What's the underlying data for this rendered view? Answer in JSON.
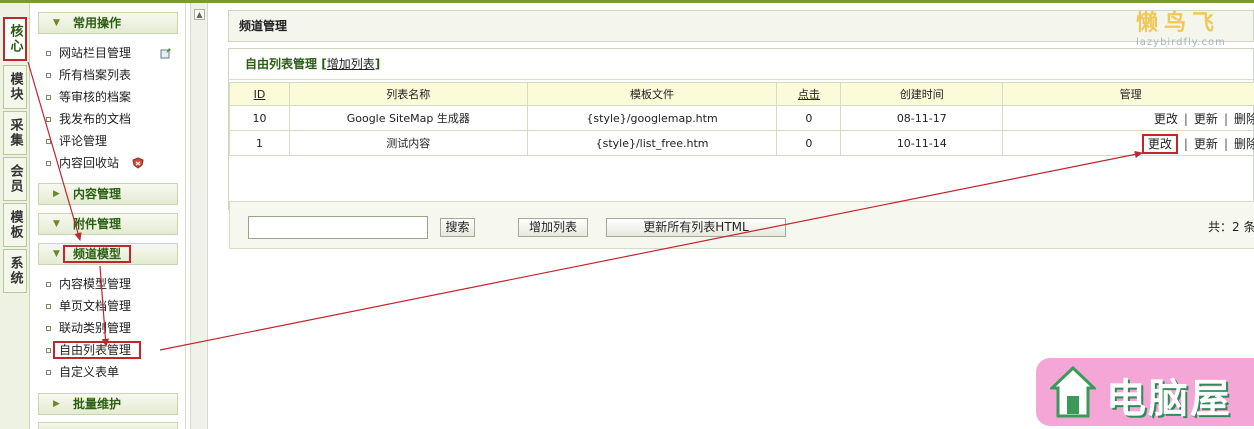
{
  "vtabs": [
    "核心",
    "模块",
    "采集",
    "会员",
    "模板",
    "系统"
  ],
  "sidebar": {
    "common_ops": "常用操作",
    "common_items": [
      "网站栏目管理",
      "所有档案列表",
      "等审核的档案",
      "我发布的文档",
      "评论管理",
      "内容回收站"
    ],
    "content_mgmt": "内容管理",
    "attach_mgmt": "附件管理",
    "channel_model": "频道模型",
    "channel_items": [
      "内容模型管理",
      "单页文档管理",
      "联动类别管理",
      "自由列表管理",
      "自定义表单"
    ],
    "batch_maint": "批量维护"
  },
  "main": {
    "title": "频道管理",
    "logo_big": "懒鸟飞",
    "logo_small": "lazybirdfly.com",
    "panel_title": "自由列表管理",
    "add_list_link": "增加列表",
    "columns": [
      "ID",
      "列表名称",
      "模板文件",
      "点击",
      "创建时间",
      "管理"
    ],
    "rows": [
      {
        "id": "10",
        "name": "Google SiteMap 生成器",
        "template": "{style}/googlemap.htm",
        "clicks": "0",
        "created": "08-11-17",
        "edit": "更改",
        "update": "更新",
        "delete": "删除"
      },
      {
        "id": "1",
        "name": "测试内容",
        "template": "{style}/list_free.htm",
        "clicks": "0",
        "created": "10-11-14",
        "edit": "更改",
        "update": "更新",
        "delete": "删除"
      }
    ],
    "search_value": "",
    "search_button": "搜索",
    "add_list_button": "增加列表",
    "update_all_button": "更新所有列表HTML",
    "total": "共：2 条"
  },
  "watermark": "电脑屋",
  "colors": {
    "accent": "#2b5e13",
    "highlight": "#c0262c",
    "header_bg": "#fbfad9"
  }
}
